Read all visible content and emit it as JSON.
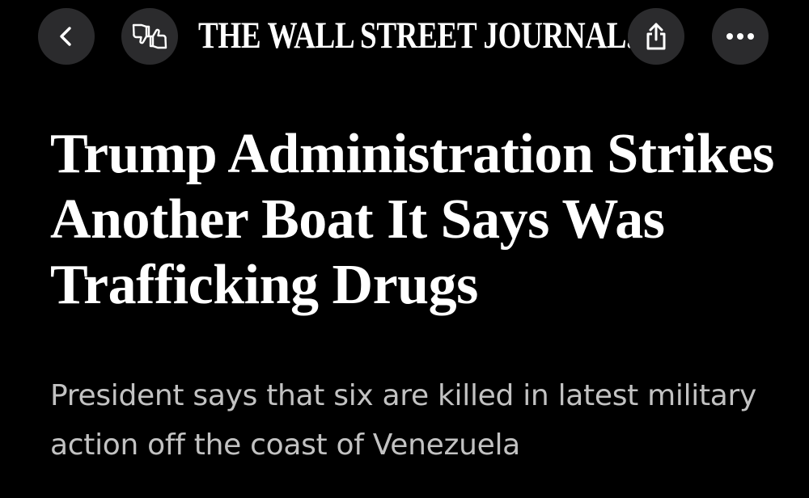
{
  "header": {
    "masthead": "THE WALL STREET JOURNAL.",
    "back_icon": "chevron-left-icon",
    "feedback_icon": "thumbs-up-down-icon",
    "share_icon": "share-icon",
    "more_icon": "ellipsis-icon",
    "button_bg": "#2b2b2d"
  },
  "article": {
    "headline": "Trump Administration Strikes Another Boat It Says Was Trafficking Drugs",
    "dek": "President says that six are killed in latest military action off the coast of Venezuela"
  },
  "colors": {
    "background": "#000000",
    "headline": "#ffffff",
    "dek": "#c2c2c2"
  }
}
